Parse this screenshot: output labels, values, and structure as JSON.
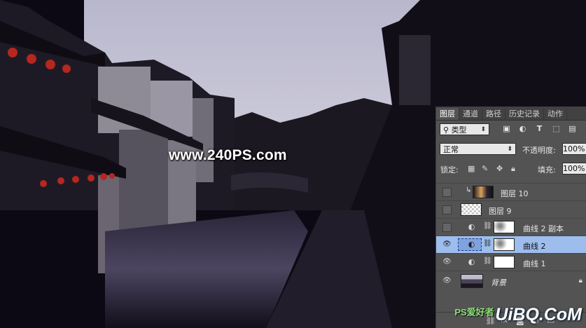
{
  "watermark": "www.240PS.com",
  "site_logo": {
    "main": "UiBQ.CoM",
    "small": "PS爱好者"
  },
  "panel": {
    "tabs": [
      {
        "label": "图层",
        "active": true
      },
      {
        "label": "通道",
        "active": false
      },
      {
        "label": "路径",
        "active": false
      },
      {
        "label": "历史记录",
        "active": false
      },
      {
        "label": "动作",
        "active": false
      }
    ],
    "filter": {
      "label": "类型",
      "icons": [
        "image-filter-icon",
        "adjustment-filter-icon",
        "type-filter-icon",
        "shape-filter-icon",
        "smart-object-filter-icon"
      ]
    },
    "blend_mode": "正常",
    "opacity_label": "不透明度:",
    "opacity_value": "100%",
    "lock_label": "锁定:",
    "fill_label": "填充:",
    "fill_value": "100%",
    "layers": [
      {
        "name": "图层 10",
        "visible": false,
        "type": "clipped-image",
        "selected": false
      },
      {
        "name": "图层 9",
        "visible": false,
        "type": "transparent",
        "selected": false
      },
      {
        "name": "曲线 2 副本",
        "visible": false,
        "type": "curves-mask",
        "selected": false
      },
      {
        "name": "曲线 2",
        "visible": true,
        "type": "curves-mask",
        "selected": true
      },
      {
        "name": "曲线 1",
        "visible": true,
        "type": "curves-white",
        "selected": false
      },
      {
        "name": "背景",
        "visible": true,
        "type": "background",
        "selected": false
      }
    ]
  },
  "colors": {
    "panel_bg": "#535353",
    "selected_row": "#9dbdec",
    "sky": "#c6c5d6",
    "water": "#1c1828"
  }
}
